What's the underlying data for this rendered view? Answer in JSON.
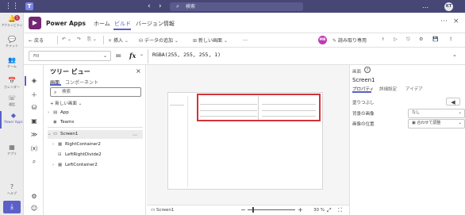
{
  "titlebar": {
    "search_placeholder": "検索",
    "more": "…",
    "avatar": "KT"
  },
  "rail": {
    "items": [
      {
        "label": "アクティビティ",
        "icon": "bell-icon",
        "glyph": "🔔",
        "badge": "5"
      },
      {
        "label": "チャット",
        "icon": "chat-icon",
        "glyph": "💬"
      },
      {
        "label": "チーム",
        "icon": "teams-icon",
        "glyph": "👥"
      },
      {
        "label": "カレンダー",
        "icon": "calendar-icon",
        "glyph": "📅"
      },
      {
        "label": "通話",
        "icon": "phone-icon",
        "glyph": "☏"
      },
      {
        "label": "Power Apps",
        "icon": "powerapps-icon",
        "glyph": "◆"
      },
      {
        "label": "アプリ",
        "icon": "apps-icon",
        "glyph": "▦"
      },
      {
        "label": "ヘルプ",
        "icon": "help-icon",
        "glyph": "?"
      }
    ],
    "download_glyph": "⤓"
  },
  "app": {
    "title": "Power Apps",
    "tabs": [
      "ホーム",
      "ビルド",
      "バージョン情報"
    ]
  },
  "toolbar": {
    "back": "戻る",
    "insert": "挿入",
    "add_data": "データの追加",
    "new_screen": "新しい画面",
    "more": "…",
    "user_initials": "MB",
    "read_only": "読み取り専用"
  },
  "formula": {
    "property": "Fill",
    "equals": "=",
    "fx": "fx",
    "expression": "RGBA(255, 255, 255, 1)"
  },
  "tree": {
    "title": "ツリー ビュー",
    "tabs": [
      "画面",
      "コンポーネント"
    ],
    "search_placeholder": "検索",
    "add_screen": "新しい画面",
    "items": [
      {
        "label": "App"
      },
      {
        "label": "Teams"
      },
      {
        "label": "Screen1"
      },
      {
        "label": "RightContainer2"
      },
      {
        "label": "LeftRightDivide2"
      },
      {
        "label": "LeftContainer2"
      }
    ]
  },
  "status": {
    "screen_name": "Screen1",
    "zoom": "30 %"
  },
  "props": {
    "kind": "画面",
    "name": "Screen1",
    "tabs": [
      "プロパティ",
      "詳細設定",
      "アイデア"
    ],
    "fill_label": "塗りつぶし",
    "bg_image_label": "背景の画像",
    "bg_image_value": "なし",
    "image_pos_label": "画像の位置",
    "image_pos_value": "合わせて調整"
  }
}
